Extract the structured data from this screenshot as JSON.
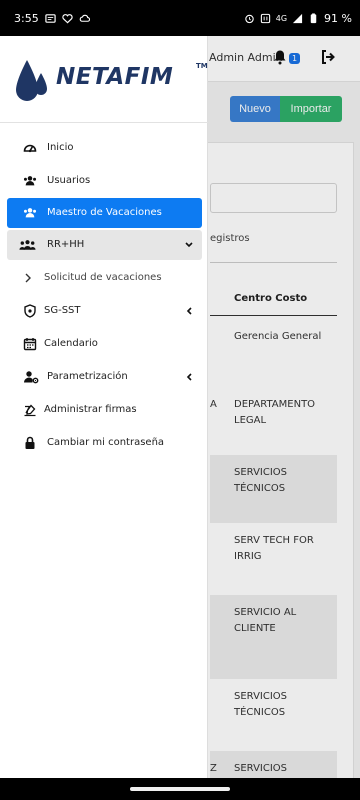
{
  "status": {
    "time": "3:55",
    "network": "4G",
    "battery": "91 %"
  },
  "header": {
    "user": "Admin Admin",
    "notifications": "1"
  },
  "toolbar": {
    "nuevo": "Nuevo",
    "importar": "Importar"
  },
  "table": {
    "registros": "egistros",
    "column": "Centro Costo",
    "rows": [
      {
        "left": "",
        "value": "Gerencia General"
      },
      {
        "left": "A",
        "value": "DEPARTAMENTO LEGAL"
      },
      {
        "left": "",
        "value": "SERVICIOS TÉCNICOS"
      },
      {
        "left": "",
        "value": "SERV TECH FOR IRRIG"
      },
      {
        "left": "",
        "value": "SERVICIO AL CLIENTE"
      },
      {
        "left": "",
        "value": "SERVICIOS TÉCNICOS"
      },
      {
        "left": "Z",
        "value": "SERVICIOS"
      }
    ]
  },
  "brand": {
    "name": "NETAFIM",
    "tm": "TM",
    "color": "#1f3664"
  },
  "menu": {
    "items": [
      {
        "label": "Inicio",
        "icon": "dashboard-icon"
      },
      {
        "label": "Usuarios",
        "icon": "users-icon"
      },
      {
        "label": "Maestro de Vacaciones",
        "icon": "users-group-icon"
      },
      {
        "label": "RR+HH",
        "icon": "people-icon"
      },
      {
        "label": "Solicitud de vacaciones",
        "icon": "chevron-right-icon"
      },
      {
        "label": "SG-SST",
        "icon": "shield-icon"
      },
      {
        "label": "Calendario",
        "icon": "calendar-icon"
      },
      {
        "label": "Parametrización",
        "icon": "user-cog-icon"
      },
      {
        "label": "Administrar firmas",
        "icon": "signature-icon"
      },
      {
        "label": "Cambiar mi contraseña",
        "icon": "lock-icon"
      }
    ]
  },
  "colors": {
    "active": "#0d7bf2",
    "nuevo": "#3b82d6",
    "importar": "#2fb06b"
  }
}
